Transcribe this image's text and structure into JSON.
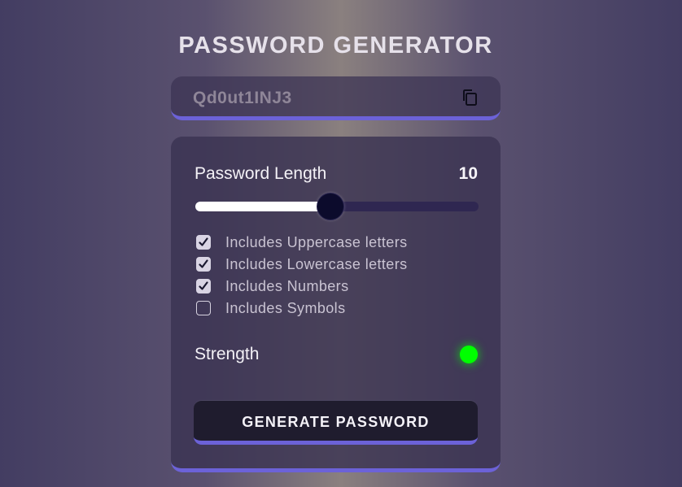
{
  "app": {
    "title": "PASSWORD GENERATOR"
  },
  "display": {
    "password": "Qd0ut1INJ3",
    "copy_icon": "copy-icon"
  },
  "length": {
    "label": "Password Length",
    "value": "10",
    "slider_fraction": 0.476
  },
  "options": [
    {
      "label": "Includes Uppercase letters",
      "checked": true
    },
    {
      "label": "Includes Lowercase letters",
      "checked": true
    },
    {
      "label": "Includes Numbers",
      "checked": true
    },
    {
      "label": "Includes Symbols",
      "checked": false
    }
  ],
  "strength": {
    "label": "Strength",
    "color": "#00ff00"
  },
  "generate": {
    "label": "GENERATE PASSWORD"
  },
  "colors": {
    "accent": "#6c62d8",
    "slider_track": "#2f2751",
    "slider_thumb": "#0c0b2c"
  }
}
